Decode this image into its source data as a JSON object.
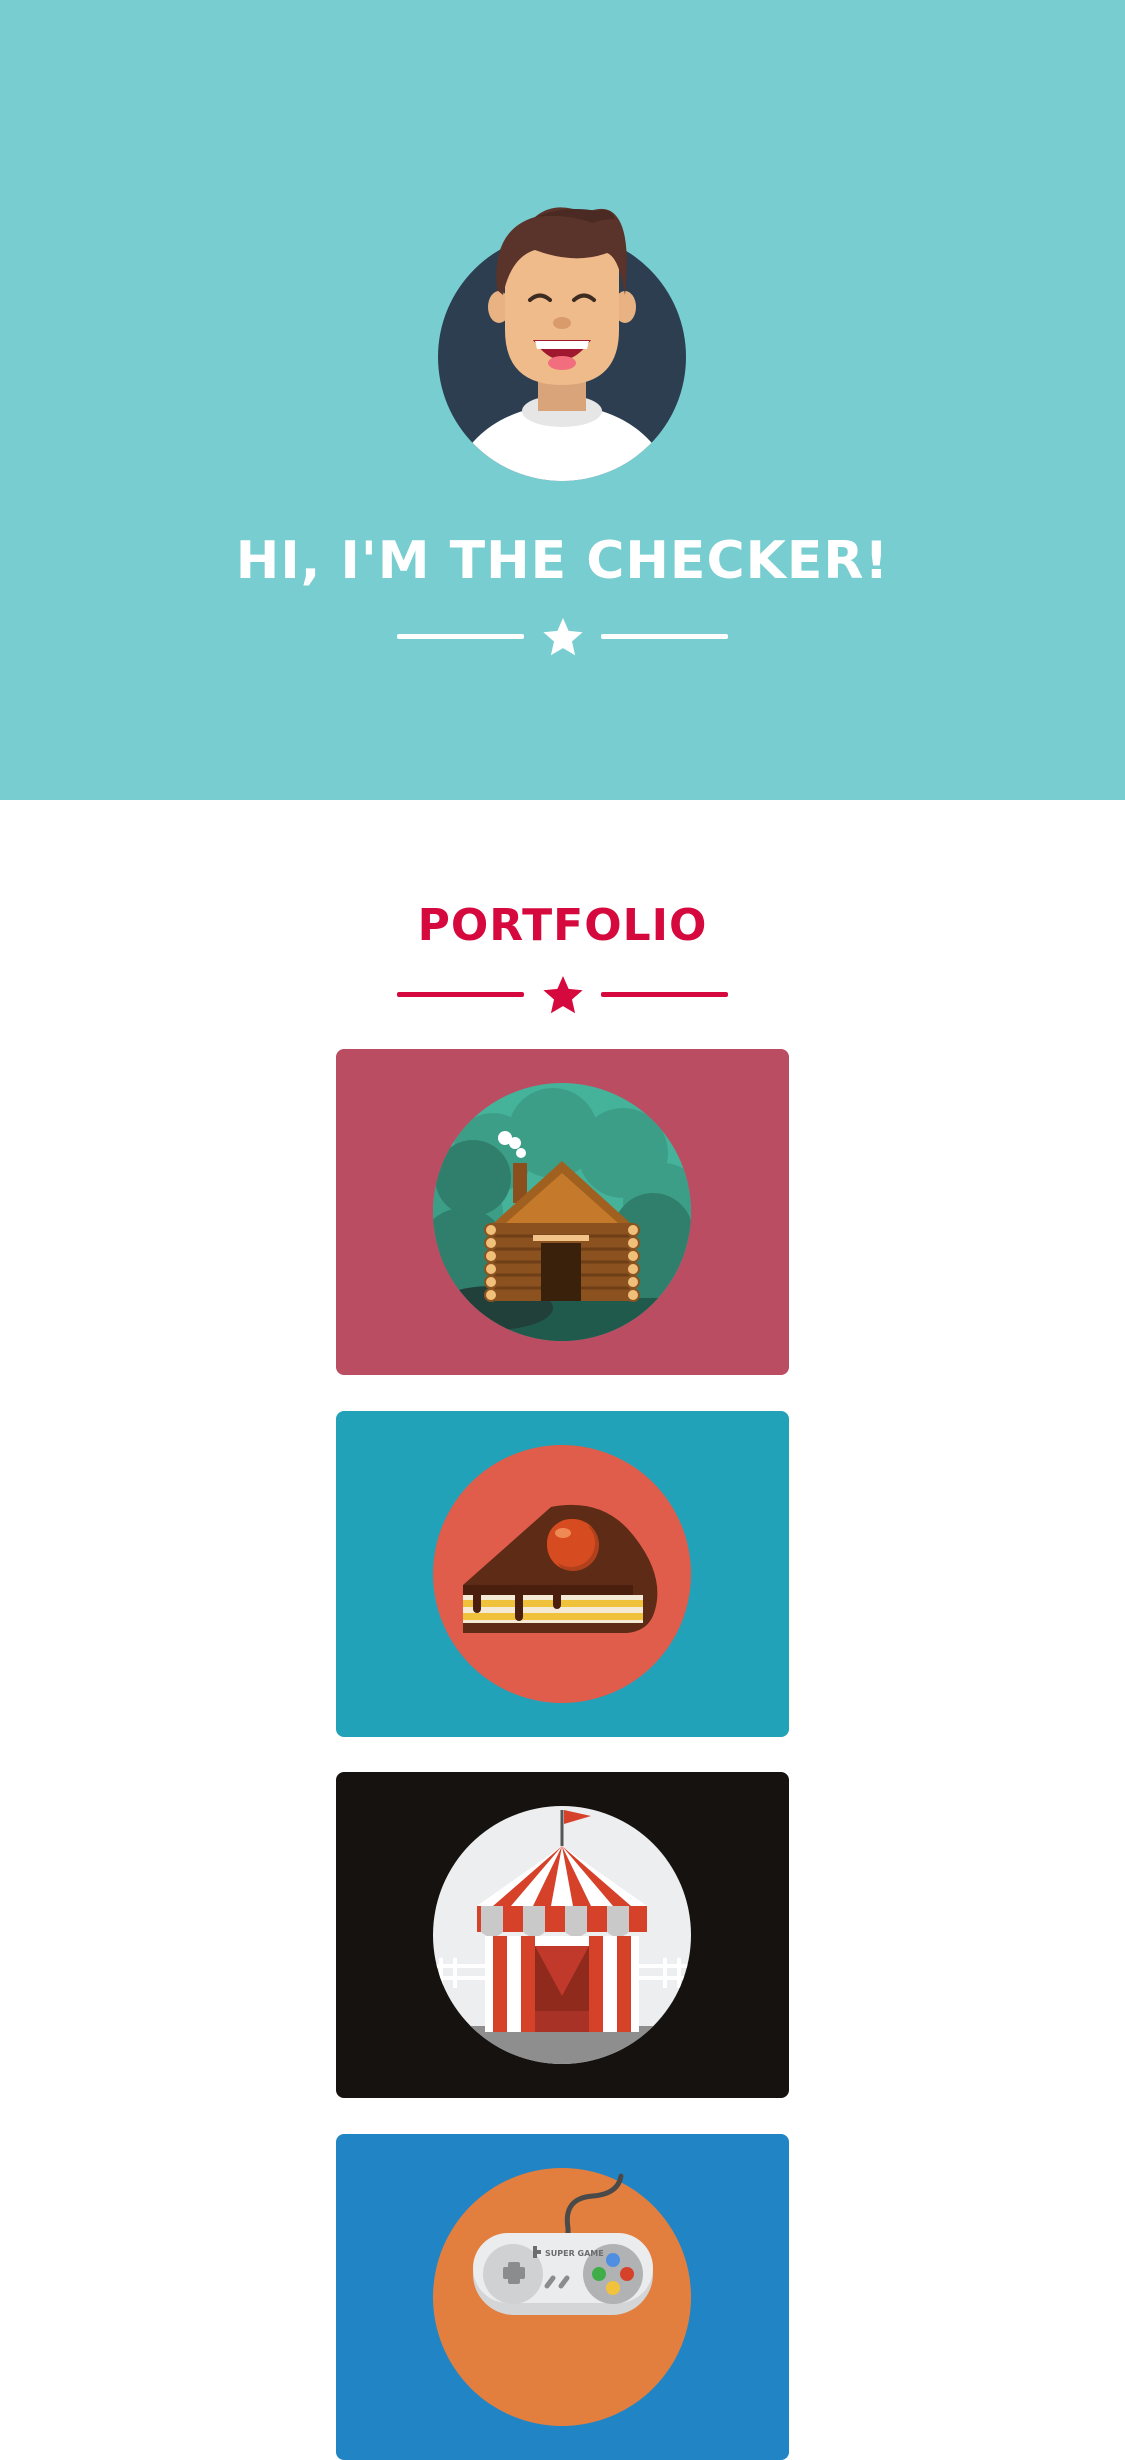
{
  "masthead": {
    "title": "HI, I'M THE CHECKER!",
    "background_color": "#78cdd1",
    "avatar_icon": "smiling-man-avatar-icon",
    "divider_icon": "star-icon"
  },
  "portfolio": {
    "title": "PORTFOLIO",
    "accent_color": "#d6093f",
    "divider_icon": "star-icon",
    "items": [
      {
        "icon": "log-cabin-icon",
        "background": "#bb4d62"
      },
      {
        "icon": "cake-slice-icon",
        "background": "#22a2b9"
      },
      {
        "icon": "circus-tent-icon",
        "background": "#161210"
      },
      {
        "icon": "game-controller-icon",
        "background": "#2185c5",
        "icon_text": "SUPER GAME"
      }
    ]
  }
}
